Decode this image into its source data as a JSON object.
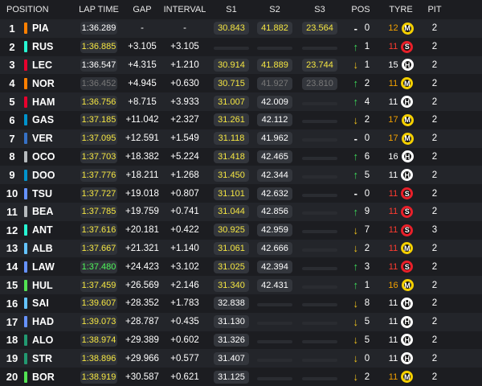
{
  "headers": {
    "position": "POSITION",
    "lap_time": "LAP TIME",
    "gap": "GAP",
    "interval": "INTERVAL",
    "s1": "S1",
    "s2": "S2",
    "s3": "S3",
    "pos": "POS",
    "tyre": "TYRE",
    "pit": "PIT"
  },
  "colors": {
    "yellow": "#f5e642",
    "purple": "#b26bff",
    "green": "#4ff75a",
    "white": "#ffffff",
    "grey": "#777777",
    "arrow_up": "#3ddc5a",
    "arrow_down": "#f0c21c",
    "tyre_medium": "#f5d000",
    "tyre_soft": "#e8202a",
    "tyre_hard": "#ffffff",
    "age_orange": "#f2a000",
    "age_red": "#ff3b30"
  },
  "rows": [
    {
      "pos": "1",
      "driver": "PIA",
      "team_color": "#ff8000",
      "lap": "1:36.289",
      "lap_style": "white",
      "gap": "-",
      "interval": "-",
      "s1": "30.843",
      "s1_style": "yellow",
      "s2": "41.882",
      "s2_style": "yellow",
      "s3": "23.564",
      "s3_style": "yellow",
      "arrow": "dash",
      "change": "0",
      "tyre_age": "12",
      "tyre_age_style": "orange",
      "tyre": "M",
      "pit": "2"
    },
    {
      "pos": "2",
      "driver": "RUS",
      "team_color": "#27f4d2",
      "lap": "1:36.885",
      "lap_style": "yellow",
      "gap": "+3.105",
      "interval": "+3.105",
      "s1": "",
      "s1_style": "empty",
      "s2": "",
      "s2_style": "empty",
      "s3": "",
      "s3_style": "empty",
      "arrow": "up",
      "change": "1",
      "tyre_age": "11",
      "tyre_age_style": "red",
      "tyre": "S",
      "pit": "2"
    },
    {
      "pos": "3",
      "driver": "LEC",
      "team_color": "#e8002d",
      "lap": "1:36.547",
      "lap_style": "white",
      "gap": "+4.315",
      "interval": "+1.210",
      "s1": "30.914",
      "s1_style": "yellow",
      "s2": "41.889",
      "s2_style": "yellow",
      "s3": "23.744",
      "s3_style": "yellow",
      "arrow": "down",
      "change": "1",
      "tyre_age": "15",
      "tyre_age_style": "white",
      "tyre": "H",
      "pit": "2"
    },
    {
      "pos": "4",
      "driver": "NOR",
      "team_color": "#ff8000",
      "lap": "1:36.452",
      "lap_style": "grey",
      "gap": "+4.945",
      "interval": "+0.630",
      "s1": "30.715",
      "s1_style": "yellow",
      "s2": "41.927",
      "s2_style": "grey",
      "s3": "23.810",
      "s3_style": "grey",
      "arrow": "up",
      "change": "2",
      "tyre_age": "11",
      "tyre_age_style": "orange",
      "tyre": "M",
      "pit": "2"
    },
    {
      "pos": "5",
      "driver": "HAM",
      "team_color": "#e8002d",
      "lap": "1:36.756",
      "lap_style": "yellow",
      "gap": "+8.715",
      "interval": "+3.933",
      "s1": "31.007",
      "s1_style": "yellow",
      "s2": "42.009",
      "s2_style": "white",
      "s3": "",
      "s3_style": "empty",
      "arrow": "up",
      "change": "4",
      "tyre_age": "11",
      "tyre_age_style": "white",
      "tyre": "H",
      "pit": "2"
    },
    {
      "pos": "6",
      "driver": "GAS",
      "team_color": "#0093cc",
      "lap": "1:37.185",
      "lap_style": "yellow",
      "gap": "+11.042",
      "interval": "+2.327",
      "s1": "31.261",
      "s1_style": "yellow",
      "s2": "42.112",
      "s2_style": "white",
      "s3": "",
      "s3_style": "empty",
      "arrow": "down",
      "change": "2",
      "tyre_age": "17",
      "tyre_age_style": "orange",
      "tyre": "M",
      "pit": "2"
    },
    {
      "pos": "7",
      "driver": "VER",
      "team_color": "#3671c6",
      "lap": "1:37.095",
      "lap_style": "yellow",
      "gap": "+12.591",
      "interval": "+1.549",
      "s1": "31.118",
      "s1_style": "yellow",
      "s2": "41.962",
      "s2_style": "white",
      "s3": "",
      "s3_style": "empty",
      "arrow": "dash",
      "change": "0",
      "tyre_age": "17",
      "tyre_age_style": "orange",
      "tyre": "M",
      "pit": "2"
    },
    {
      "pos": "8",
      "driver": "OCO",
      "team_color": "#b6babd",
      "lap": "1:37.703",
      "lap_style": "yellow",
      "gap": "+18.382",
      "interval": "+5.224",
      "s1": "31.418",
      "s1_style": "yellow",
      "s2": "42.465",
      "s2_style": "white",
      "s3": "",
      "s3_style": "empty",
      "arrow": "up",
      "change": "6",
      "tyre_age": "16",
      "tyre_age_style": "white",
      "tyre": "H",
      "pit": "2"
    },
    {
      "pos": "9",
      "driver": "DOO",
      "team_color": "#0093cc",
      "lap": "1:37.776",
      "lap_style": "yellow",
      "gap": "+18.211",
      "interval": "+1.268",
      "s1": "31.450",
      "s1_style": "yellow",
      "s2": "42.344",
      "s2_style": "white",
      "s3": "",
      "s3_style": "empty",
      "arrow": "up",
      "change": "5",
      "tyre_age": "11",
      "tyre_age_style": "white",
      "tyre": "H",
      "pit": "2"
    },
    {
      "pos": "10",
      "driver": "TSU",
      "team_color": "#6692ff",
      "lap": "1:37.727",
      "lap_style": "yellow",
      "gap": "+19.018",
      "interval": "+0.807",
      "s1": "31.101",
      "s1_style": "yellow",
      "s2": "42.632",
      "s2_style": "white",
      "s3": "",
      "s3_style": "empty",
      "arrow": "dash",
      "change": "0",
      "tyre_age": "11",
      "tyre_age_style": "red",
      "tyre": "S",
      "pit": "2"
    },
    {
      "pos": "11",
      "driver": "BEA",
      "team_color": "#b6babd",
      "lap": "1:37.785",
      "lap_style": "yellow",
      "gap": "+19.759",
      "interval": "+0.741",
      "s1": "31.044",
      "s1_style": "yellow",
      "s2": "42.856",
      "s2_style": "white",
      "s3": "",
      "s3_style": "empty",
      "arrow": "up",
      "change": "9",
      "tyre_age": "11",
      "tyre_age_style": "red",
      "tyre": "S",
      "pit": "2"
    },
    {
      "pos": "12",
      "driver": "ANT",
      "team_color": "#27f4d2",
      "lap": "1:37.616",
      "lap_style": "yellow",
      "gap": "+20.181",
      "interval": "+0.422",
      "s1": "30.925",
      "s1_style": "yellow",
      "s2": "42.959",
      "s2_style": "white",
      "s3": "",
      "s3_style": "empty",
      "arrow": "down",
      "change": "7",
      "tyre_age": "11",
      "tyre_age_style": "red",
      "tyre": "S",
      "pit": "3"
    },
    {
      "pos": "13",
      "driver": "ALB",
      "team_color": "#64c4ff",
      "lap": "1:37.667",
      "lap_style": "yellow",
      "gap": "+21.321",
      "interval": "+1.140",
      "s1": "31.061",
      "s1_style": "yellow",
      "s2": "42.666",
      "s2_style": "white",
      "s3": "",
      "s3_style": "empty",
      "arrow": "down",
      "change": "2",
      "tyre_age": "11",
      "tyre_age_style": "red",
      "tyre": "M",
      "pit": "2"
    },
    {
      "pos": "14",
      "driver": "LAW",
      "team_color": "#6692ff",
      "lap": "1:37.480",
      "lap_style": "green",
      "gap": "+24.423",
      "interval": "+3.102",
      "s1": "31.025",
      "s1_style": "yellow",
      "s2": "42.394",
      "s2_style": "white",
      "s3": "",
      "s3_style": "empty",
      "arrow": "up",
      "change": "3",
      "tyre_age": "11",
      "tyre_age_style": "red",
      "tyre": "S",
      "pit": "2"
    },
    {
      "pos": "15",
      "driver": "HUL",
      "team_color": "#52e252",
      "lap": "1:37.459",
      "lap_style": "yellow",
      "gap": "+26.569",
      "interval": "+2.146",
      "s1": "31.340",
      "s1_style": "yellow",
      "s2": "42.431",
      "s2_style": "white",
      "s3": "",
      "s3_style": "empty",
      "arrow": "up",
      "change": "1",
      "tyre_age": "16",
      "tyre_age_style": "orange",
      "tyre": "M",
      "pit": "2"
    },
    {
      "pos": "16",
      "driver": "SAI",
      "team_color": "#64c4ff",
      "lap": "1:39.607",
      "lap_style": "yellow",
      "gap": "+28.352",
      "interval": "+1.783",
      "s1": "32.838",
      "s1_style": "white",
      "s2": "",
      "s2_style": "empty",
      "s3": "",
      "s3_style": "empty",
      "arrow": "down",
      "change": "8",
      "tyre_age": "11",
      "tyre_age_style": "white",
      "tyre": "H",
      "pit": "2"
    },
    {
      "pos": "17",
      "driver": "HAD",
      "team_color": "#6692ff",
      "lap": "1:39.073",
      "lap_style": "yellow",
      "gap": "+28.787",
      "interval": "+0.435",
      "s1": "31.130",
      "s1_style": "white",
      "s2": "",
      "s2_style": "empty",
      "s3": "",
      "s3_style": "empty",
      "arrow": "down",
      "change": "5",
      "tyre_age": "11",
      "tyre_age_style": "white",
      "tyre": "H",
      "pit": "2"
    },
    {
      "pos": "18",
      "driver": "ALO",
      "team_color": "#229971",
      "lap": "1:38.974",
      "lap_style": "yellow",
      "gap": "+29.389",
      "interval": "+0.602",
      "s1": "31.326",
      "s1_style": "white",
      "s2": "",
      "s2_style": "empty",
      "s3": "",
      "s3_style": "empty",
      "arrow": "down",
      "change": "5",
      "tyre_age": "11",
      "tyre_age_style": "white",
      "tyre": "H",
      "pit": "2"
    },
    {
      "pos": "19",
      "driver": "STR",
      "team_color": "#229971",
      "lap": "1:38.896",
      "lap_style": "yellow",
      "gap": "+29.966",
      "interval": "+0.577",
      "s1": "31.407",
      "s1_style": "white",
      "s2": "",
      "s2_style": "empty",
      "s3": "",
      "s3_style": "empty",
      "arrow": "down",
      "change": "0",
      "tyre_age": "11",
      "tyre_age_style": "white",
      "tyre": "H",
      "pit": "2"
    },
    {
      "pos": "20",
      "driver": "BOR",
      "team_color": "#52e252",
      "lap": "1:38.919",
      "lap_style": "yellow",
      "gap": "+30.587",
      "interval": "+0.621",
      "s1": "31.125",
      "s1_style": "white",
      "s2": "",
      "s2_style": "empty",
      "s3": "",
      "s3_style": "empty",
      "arrow": "down",
      "change": "2",
      "tyre_age": "11",
      "tyre_age_style": "orange",
      "tyre": "M",
      "pit": "2"
    }
  ]
}
